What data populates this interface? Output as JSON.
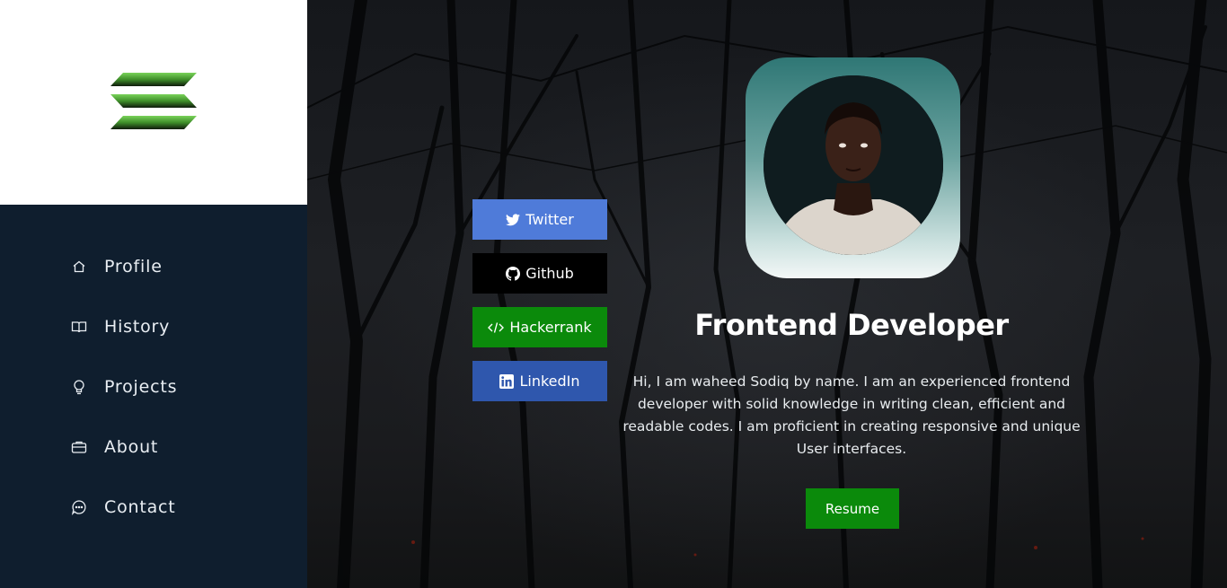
{
  "brand": {
    "logo_icon": "stacked-bars-logo",
    "accent": "#4a9a2a"
  },
  "nav": {
    "items": [
      {
        "label": "Profile",
        "icon": "home-icon"
      },
      {
        "label": "History",
        "icon": "book-icon"
      },
      {
        "label": "Projects",
        "icon": "lightbulb-icon"
      },
      {
        "label": "About",
        "icon": "briefcase-icon"
      },
      {
        "label": "Contact",
        "icon": "chat-icon"
      }
    ]
  },
  "social": {
    "twitter": {
      "label": "Twitter",
      "color": "#4f7bd9",
      "icon": "twitter-icon"
    },
    "github": {
      "label": "Github",
      "color": "#000000",
      "icon": "github-icon"
    },
    "hackerrank": {
      "label": "Hackerrank",
      "color": "#0b8a0b",
      "icon": "code-icon"
    },
    "linkedin": {
      "label": "LinkedIn",
      "color": "#2f57ad",
      "icon": "linkedin-icon"
    }
  },
  "hero": {
    "title": "Frontend Developer",
    "bio": "Hi, I am waheed Sodiq by name. I am an experienced frontend developer with solid knowledge in writing clean, efficient and readable codes. I am proficient in creating responsive and unique User interfaces.",
    "resume_label": "Resume"
  },
  "colors": {
    "sidebar_bg": "#0f1e2e",
    "button_green": "#0b8a0b"
  }
}
